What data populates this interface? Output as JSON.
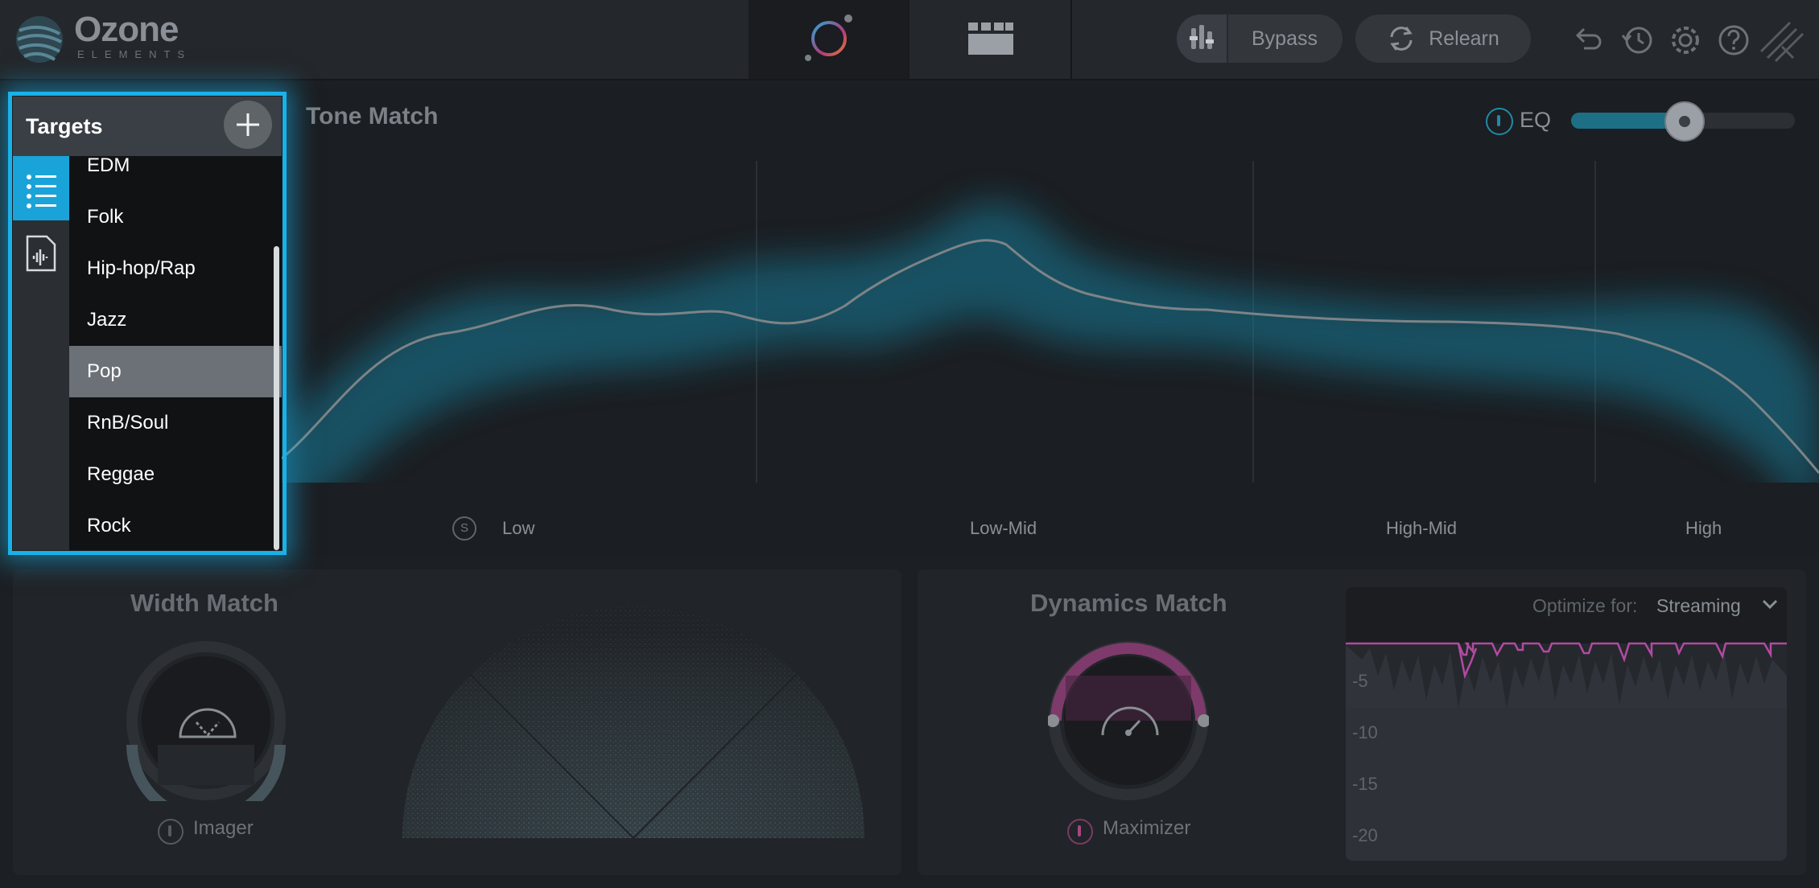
{
  "app": {
    "logo_text": "Ozone",
    "logo_sub": "ELEMENTS"
  },
  "header": {
    "bypass_label": "Bypass",
    "relearn_label": "Relearn",
    "icons": [
      "undo-icon",
      "history-icon",
      "gear-icon",
      "help-icon",
      "logo-mark-icon"
    ]
  },
  "tone_match": {
    "title": "Tone Match",
    "eq_label": "EQ",
    "eq_slider": 0.5,
    "solo_label": "S",
    "bands": [
      "Low",
      "Low-Mid",
      "High-Mid",
      "High"
    ]
  },
  "width_match": {
    "title": "Width Match",
    "module_label": "Imager"
  },
  "dynamics_match": {
    "title": "Dynamics Match",
    "module_label": "Maximizer",
    "optimize_label": "Optimize for:",
    "optimize_value": "Streaming",
    "db_ticks": [
      "-5",
      "-10",
      "-15",
      "-20"
    ]
  },
  "targets": {
    "title": "Targets",
    "items": [
      "EDM",
      "Folk",
      "Hip-hop/Rap",
      "Jazz",
      "Pop",
      "RnB/Soul",
      "Reggae",
      "Rock"
    ],
    "selected": "Pop"
  },
  "colors": {
    "accent": "#1ab1e8",
    "curve_glow": "#1590b0",
    "maximizer": "#c04a9a"
  }
}
